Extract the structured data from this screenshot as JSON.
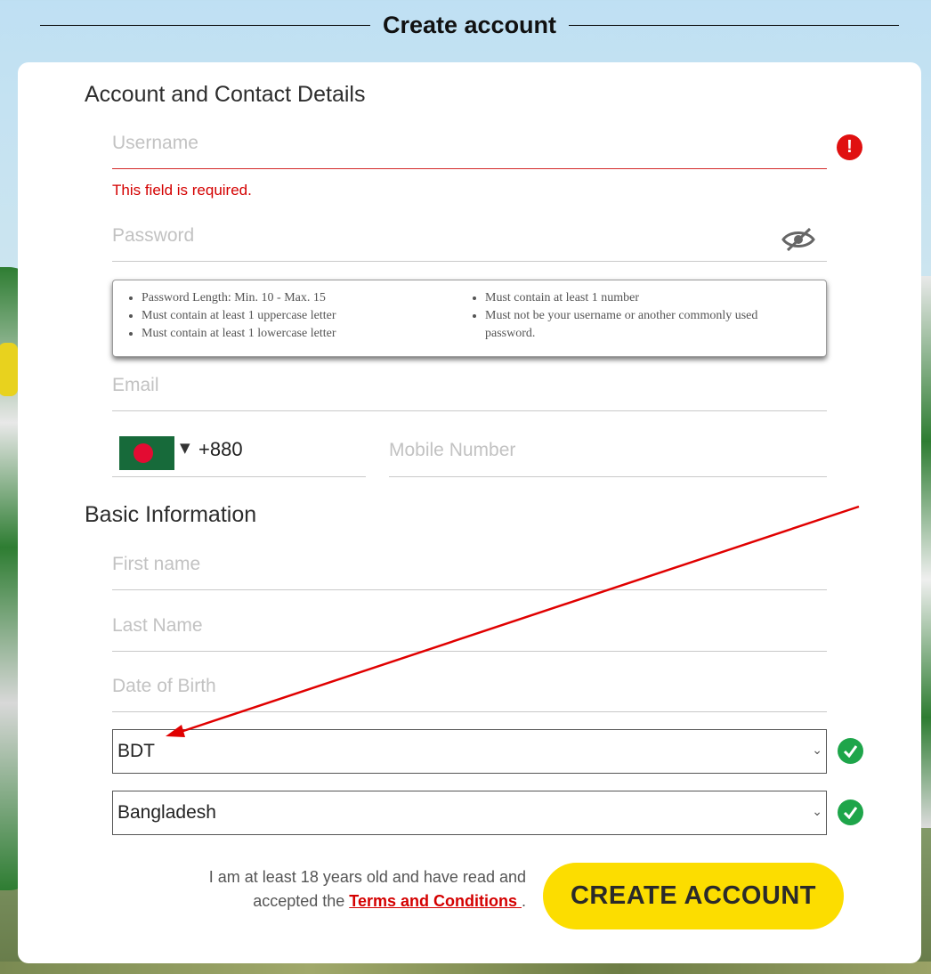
{
  "header": {
    "title": "Create account"
  },
  "sections": {
    "account": "Account and Contact Details",
    "basic": "Basic Information"
  },
  "username": {
    "placeholder": "Username",
    "error": "This field is required."
  },
  "password": {
    "placeholder": "Password",
    "rules_left": [
      "Password Length: Min. 10 - Max. 15",
      "Must contain at least 1 uppercase letter",
      "Must contain at least 1 lowercase letter"
    ],
    "rules_right": [
      "Must contain at least 1 number",
      "Must not be your username or another commonly used password."
    ]
  },
  "email": {
    "placeholder": "Email"
  },
  "phone": {
    "dial_code": "+880",
    "placeholder": "Mobile Number"
  },
  "first_name": {
    "placeholder": "First name"
  },
  "last_name": {
    "placeholder": "Last Name"
  },
  "dob": {
    "placeholder": "Date of Birth"
  },
  "currency": {
    "value": "BDT"
  },
  "country": {
    "value": "Bangladesh"
  },
  "terms": {
    "text_before": "I am at least 18 years old and have read and accepted the ",
    "link": "Terms and Conditions ",
    "text_after": "."
  },
  "submit": {
    "label": "CREATE ACCOUNT"
  },
  "colors": {
    "error": "#d40000",
    "success": "#1ea54a",
    "button": "#fcdd00",
    "annotation_arrow": "#e00000"
  }
}
